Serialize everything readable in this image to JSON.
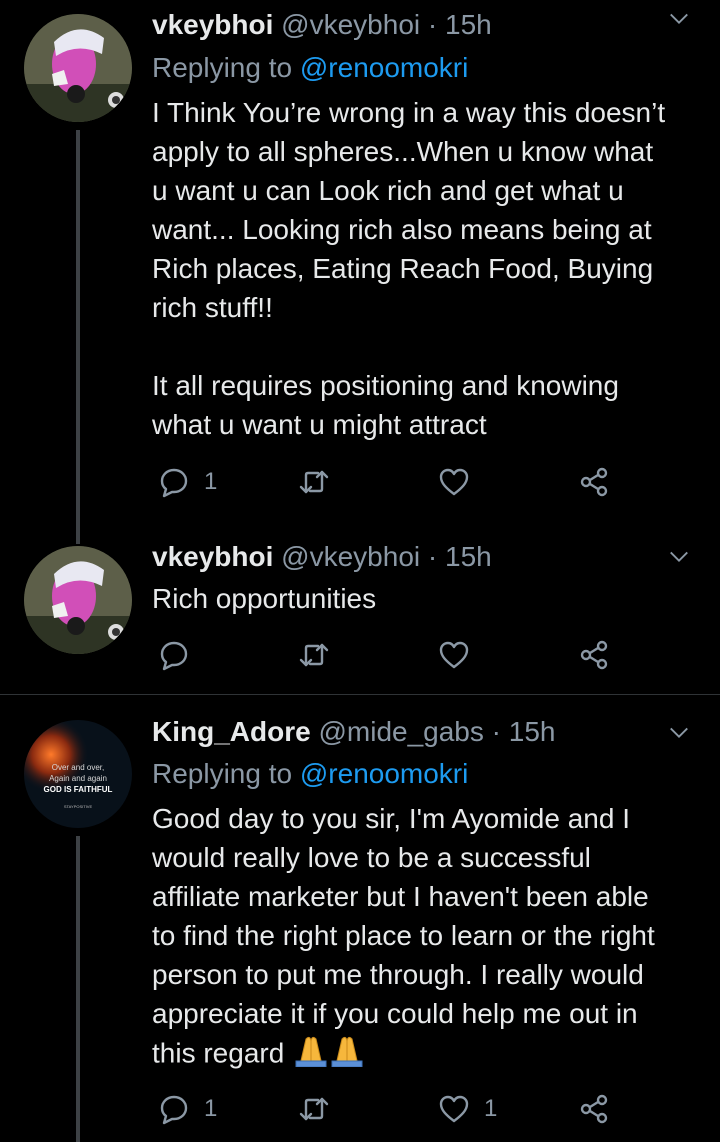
{
  "tweets": [
    {
      "name": "vkeybhoi",
      "handle": "@vkeybhoi",
      "time": "· 15h",
      "replying_prefix": "Replying to ",
      "replying_to": "@renoomokri",
      "text": "I Think You’re wrong in a way this doesn’t\napply to all spheres...When u know what\nu want u can Look rich and get what u\nwant... Looking rich also means being at\nRich places, Eating Reach Food, Buying\nrich stuff!!\n\nIt all requires positioning and knowing\nwhat u want u might attract",
      "reply_count": "1",
      "retweet_count": "",
      "like_count": ""
    },
    {
      "name": "vkeybhoi",
      "handle": "@vkeybhoi",
      "time": "· 15h",
      "text": "Rich opportunities",
      "reply_count": "",
      "retweet_count": "",
      "like_count": ""
    },
    {
      "name": "King_Adore",
      "handle": "@mide_gabs",
      "time": "· 15h",
      "replying_prefix": "Replying to ",
      "replying_to": "@renoomokri",
      "text": "Good day to you sir, I'm Ayomide and I\nwould really love to be a successful\naffiliate marketer but I haven't been able\nto find the right place to learn or the right\nperson to put me through. I really would\nappreciate it if you could help me out in\nthis regard ",
      "emoji": "folded-hands-x2",
      "reply_count": "1",
      "retweet_count": "",
      "like_count": "1",
      "avatar_text": {
        "line1": "Over and over,",
        "line2": "Again and again",
        "line3": "GOD IS FAITHFUL",
        "line4": "STAYPOSITIVE"
      }
    }
  ],
  "colors": {
    "background": "#000000",
    "text": "#e7e9ea",
    "muted": "#8b98a5",
    "link": "#1d9bf0",
    "divider": "#2f3336"
  },
  "icons": [
    "reply-icon",
    "retweet-icon",
    "like-icon",
    "share-icon",
    "chevron-down-icon"
  ]
}
